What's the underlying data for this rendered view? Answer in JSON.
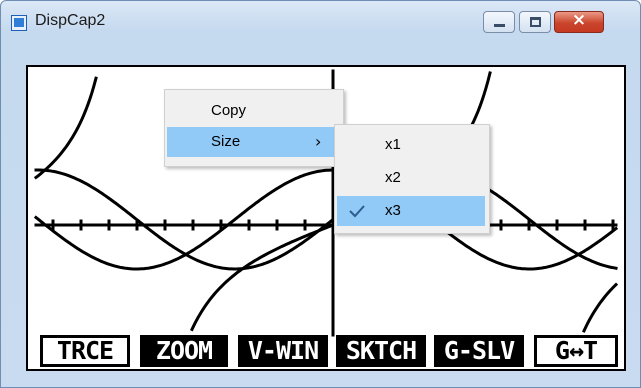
{
  "window": {
    "title": "DispCap2",
    "icon": "app-window-icon",
    "caption_buttons": {
      "minimize": "minimize-icon",
      "maximize": "maximize-icon",
      "close_glyph": "×"
    }
  },
  "graph_screen": {
    "softkeys": [
      "TRCE",
      "ZOOM",
      "V-WIN",
      "SKTCH",
      "G-SLV",
      "G↔T"
    ],
    "softkey_inverted": [
      false,
      true,
      true,
      true,
      true,
      false
    ]
  },
  "context_menu": {
    "items": [
      {
        "label": "Copy",
        "has_submenu": false,
        "highlighted": false
      },
      {
        "label": "Size",
        "has_submenu": true,
        "highlighted": true,
        "chevron": "›"
      }
    ]
  },
  "size_submenu": {
    "items": [
      {
        "label": "x1",
        "checked": false
      },
      {
        "label": "x2",
        "checked": false
      },
      {
        "label": "x3",
        "checked": true,
        "highlighted": true
      }
    ]
  },
  "colors": {
    "menu_highlight": "#91c9f7",
    "menu_background": "#f0f0f0",
    "close_button": "#c53a21",
    "titlebar": "#c5d9ef"
  }
}
